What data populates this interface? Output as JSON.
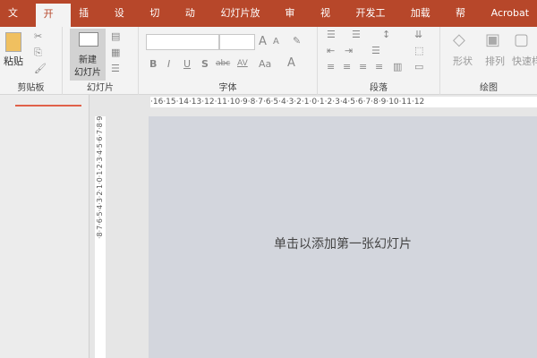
{
  "tabs": [
    "文件",
    "开始",
    "插入",
    "设计",
    "切换",
    "动画",
    "幻灯片放映",
    "审阅",
    "视图",
    "开发工具",
    "加载项",
    "帮助",
    "Acrobat"
  ],
  "active_tab": "开始",
  "ribbon": {
    "clipboard": {
      "paste": "粘贴",
      "label": "剪贴板"
    },
    "slides": {
      "new_slide_line1": "新建",
      "new_slide_line2": "幻灯片",
      "label": "幻灯片"
    },
    "font": {
      "label": "字体",
      "bold": "B",
      "italic": "I",
      "underline": "U",
      "shadow": "S",
      "strike": "abc",
      "spacing": "AV",
      "case": "Aa",
      "color": "A",
      "grow": "A",
      "shrink": "A"
    },
    "paragraph": {
      "label": "段落"
    },
    "drawing": {
      "shapes": "形状",
      "arrange": "排列",
      "quick_styles": "快速样",
      "label": "绘图"
    }
  },
  "ruler_h": "·16·15·14·13·12·11·10·9·8·7·6·5·4·3·2·1·0·1·2·3·4·5·6·7·8·9·10·11·12",
  "ruler_v": "·8·7·6·5·4·3·2·1·0·1·2·3·4·5·6·7·8·9",
  "slide": {
    "placeholder": "单击以添加第一张幻灯片"
  },
  "colors": {
    "accent": "#b7472a",
    "slide_bg": "#d3d6dd"
  }
}
